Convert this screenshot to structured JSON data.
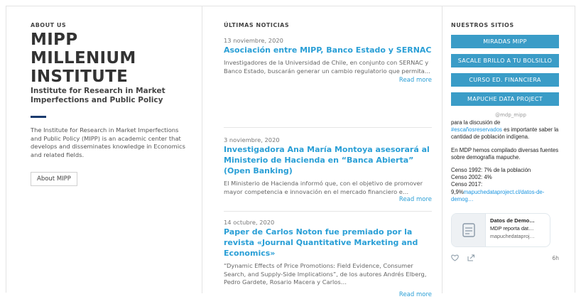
{
  "about": {
    "label": "ABOUT US",
    "title_line1": "MIPP",
    "title_line2": "MILLENIUM",
    "title_line3": "INSTITUTE",
    "subtitle": "Institute for Research in Market Imperfections and Public Policy",
    "description": "The Institute for Research in Market Imperfections and Public Policy (MIPP) is an academic center that develops and disseminates knowledge in Economics and related fields.",
    "button_label": "About MIPP"
  },
  "news": {
    "heading": "ÚLTIMAS NOTICIAS",
    "read_more_label": "Read more",
    "items": [
      {
        "date": "13 noviembre, 2020",
        "title": "Asociación entre MIPP, Banco Estado y SERNAC",
        "excerpt": "Investigadores de la Universidad de Chile, en conjunto con SERNAC y Banco Estado, buscarán generar un cambio regulatorio que permita…"
      },
      {
        "date": "3 noviembre, 2020",
        "title": "Investigadora Ana María Montoya asesorará al Ministerio de Hacienda en “Banca Abierta” (Open Banking)",
        "excerpt": "El Ministerio de Hacienda informó que, con el objetivo de promover mayor competencia e innovación en el mercado financiero e…"
      },
      {
        "date": "14 octubre, 2020",
        "title": "Paper de Carlos Noton fue premiado por la revista «Journal Quantitative Marketing and Economics»",
        "excerpt": "“Dynamic Effects of Price Promotions: Field Evidence, Consumer Search, and Supply-Side Implications”, de los autores Andrés Elberg, Pedro Gardete, Rosario Macera y Carlos…"
      }
    ]
  },
  "sites": {
    "heading": "NUESTROS SITIOS",
    "buttons": [
      "MIRADAS MIPP",
      "SACALE BRILLO A TU BOLSILLO",
      "CURSO ED. FINANCIERA",
      "MAPUCHE DATA PROJECT"
    ]
  },
  "tweet": {
    "handle": "@mdp_mipp",
    "line1": "para la discusión de",
    "hashtag": "#escañosreservados",
    "line2_rest": " es importante saber la cantidad de población indígena.",
    "para2": "En MDP hemos compilado diversas fuentes sobre demografía mapuche.",
    "census1": "Censo 1992: 7% de la población",
    "census2": "Censo 2002: 4%",
    "census3": "Censo 2017:",
    "census4_prefix": "9,9%",
    "link": "mapuchedataproject.cl/datos-de-demog…",
    "card_title": "Datos de Demo…",
    "card_desc": "MDP reporta dat…",
    "card_url": "mapuchedataproj…",
    "time": "6h",
    "colors": {
      "link": "#1b95e0"
    }
  },
  "colors": {
    "accent_link": "#2a9fd6",
    "site_button": "#3a9cc7",
    "divider": "#1a3b6e"
  }
}
